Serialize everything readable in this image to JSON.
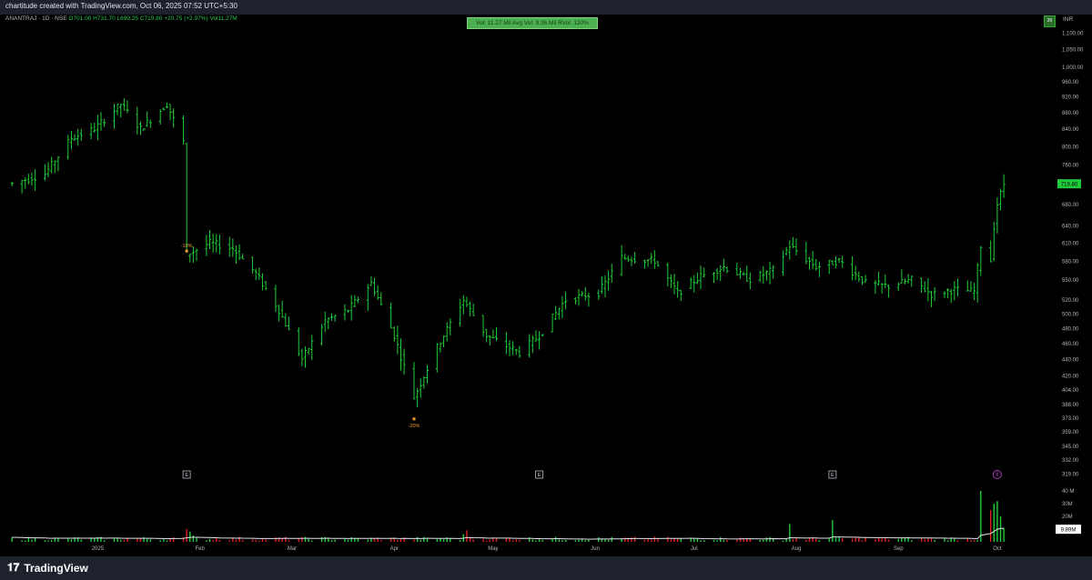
{
  "header": {
    "title": "chartitude created with TradingView.com, Oct 06, 2025 07:52 UTC+5:30"
  },
  "legend": {
    "symbol": "ANANTRAJ · 1D · NSE",
    "open": "O701.00",
    "high": "H731.70",
    "low": "L699.25",
    "close": "C719.80",
    "change": "+20.75 (+2.97%)",
    "volume": "Vol11.27M"
  },
  "stats_box": {
    "text": "Vol: 11.27 Mil   Avg Vol: 9.36 Mil   RVol: 120%"
  },
  "top_right": {
    "button": "20",
    "currency": "INR"
  },
  "footer": {
    "brand": "TradingView",
    "brand_icon": "tradingview-logo-icon"
  },
  "colors": {
    "up": "#1fcc3a",
    "down": "#e02020",
    "background": "#000000",
    "axis_text": "#b2b5be",
    "price_label_bg": "#1fcc3a",
    "volume_avg_line": "#e0e3eb"
  },
  "chart_data": {
    "type": "bar",
    "style": "ohlc-bars",
    "scale": "log",
    "grid": false,
    "y_ticks": [
      "1,100.00",
      "1,050.00",
      "1,000.00",
      "960.00",
      "920.00",
      "880.00",
      "840.00",
      "800.00",
      "760.00",
      "720.00",
      "680.00",
      "640.00",
      "610.00",
      "580.00",
      "550.00",
      "520.00",
      "500.00",
      "480.00",
      "460.00",
      "440.00",
      "420.00",
      "404.00",
      "388.00",
      "373.00",
      "359.00",
      "345.00",
      "332.00",
      "319.00"
    ],
    "x_ticks": [
      "2025",
      "Feb",
      "Mar",
      "Apr",
      "May",
      "Jun",
      "Jul",
      "Aug",
      "Sep",
      "Oct"
    ],
    "last_price": "719.80",
    "last_volume": "9.89M",
    "volume_ticks": [
      "40 M",
      "30M",
      "20M"
    ],
    "annotations": [
      {
        "text": "-10%",
        "date": "2025-01-28",
        "price": 596
      },
      {
        "text": "-20%",
        "date": "2025-04-07",
        "price": 372
      }
    ],
    "event_markers": [
      {
        "label": "E",
        "date": "2025-01-28"
      },
      {
        "label": "E",
        "date": "2025-05-15"
      },
      {
        "label": "E",
        "date": "2025-08-12"
      },
      {
        "label": "¢",
        "date": "2025-10-01",
        "kind": "dividend"
      }
    ],
    "anchors": [
      {
        "date": "2024-12-06",
        "price": 720
      },
      {
        "date": "2024-12-16",
        "price": 740
      },
      {
        "date": "2024-12-24",
        "price": 818
      },
      {
        "date": "2024-12-31",
        "price": 840
      },
      {
        "date": "2025-01-08",
        "price": 900
      },
      {
        "date": "2025-01-14",
        "price": 840
      },
      {
        "date": "2025-01-22",
        "price": 900
      },
      {
        "date": "2025-01-27",
        "price": 810
      },
      {
        "date": "2025-01-28",
        "price": 590
      },
      {
        "date": "2025-02-04",
        "price": 610
      },
      {
        "date": "2025-02-11",
        "price": 600
      },
      {
        "date": "2025-02-18",
        "price": 560
      },
      {
        "date": "2025-02-25",
        "price": 505
      },
      {
        "date": "2025-03-04",
        "price": 440
      },
      {
        "date": "2025-03-11",
        "price": 490
      },
      {
        "date": "2025-03-18",
        "price": 505
      },
      {
        "date": "2025-03-25",
        "price": 545
      },
      {
        "date": "2025-04-01",
        "price": 470
      },
      {
        "date": "2025-04-07",
        "price": 395
      },
      {
        "date": "2025-04-14",
        "price": 455
      },
      {
        "date": "2025-04-22",
        "price": 520
      },
      {
        "date": "2025-04-29",
        "price": 470
      },
      {
        "date": "2025-05-09",
        "price": 448
      },
      {
        "date": "2025-05-15",
        "price": 470
      },
      {
        "date": "2025-05-23",
        "price": 520
      },
      {
        "date": "2025-06-02",
        "price": 530
      },
      {
        "date": "2025-06-09",
        "price": 585
      },
      {
        "date": "2025-06-19",
        "price": 580
      },
      {
        "date": "2025-06-26",
        "price": 530
      },
      {
        "date": "2025-07-03",
        "price": 555
      },
      {
        "date": "2025-07-10",
        "price": 570
      },
      {
        "date": "2025-07-18",
        "price": 550
      },
      {
        "date": "2025-07-25",
        "price": 565
      },
      {
        "date": "2025-07-30",
        "price": 605
      },
      {
        "date": "2025-08-07",
        "price": 570
      },
      {
        "date": "2025-08-14",
        "price": 580
      },
      {
        "date": "2025-08-22",
        "price": 545
      },
      {
        "date": "2025-08-29",
        "price": 540
      },
      {
        "date": "2025-09-05",
        "price": 550
      },
      {
        "date": "2025-09-11",
        "price": 528
      },
      {
        "date": "2025-09-18",
        "price": 535
      },
      {
        "date": "2025-09-24",
        "price": 532
      },
      {
        "date": "2025-09-26",
        "price": 605
      },
      {
        "date": "2025-09-29",
        "price": 580
      },
      {
        "date": "2025-09-30",
        "price": 640
      },
      {
        "date": "2025-10-01",
        "price": 680
      },
      {
        "date": "2025-10-02",
        "price": 700
      },
      {
        "date": "2025-10-03",
        "price": 719.8
      }
    ]
  }
}
